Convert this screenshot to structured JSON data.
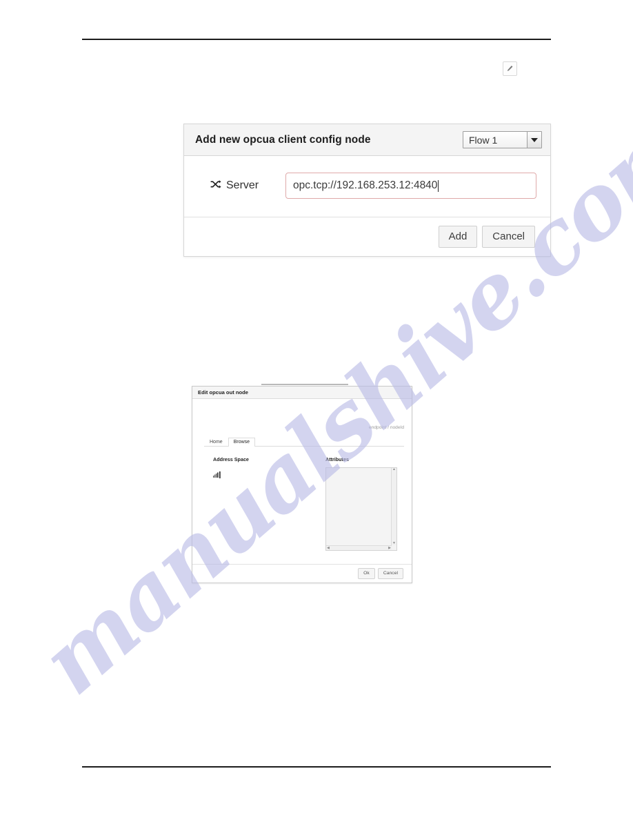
{
  "page": {
    "rules": {
      "top": "horizontal-rule",
      "bottom": "horizontal-rule"
    },
    "edit_button_icon": "pencil-icon"
  },
  "watermark": {
    "text": "manualshive.com",
    "color": "#b9bbe6"
  },
  "dialog_add_config": {
    "title": "Add new opcua client config node",
    "flow_select": {
      "selected": "Flow 1",
      "options": [
        "Flow 1"
      ],
      "arrow_icon": "chevron-down-icon"
    },
    "fields": [
      {
        "icon": "shuffle-icon",
        "label": "Server",
        "value": "opc.tcp://192.168.253.12:4840",
        "placeholder": "opc.tcp://",
        "border_color": "#dfa9a9"
      }
    ],
    "buttons": {
      "primary": "Add",
      "secondary": "Cancel"
    }
  },
  "dialog_edit_out_node": {
    "title": "Edit opcua out node",
    "breadcrumb": "endpoint / nodeId",
    "tabs": [
      {
        "label": "Home",
        "active": false
      },
      {
        "label": "Browse",
        "active": true
      }
    ],
    "columns": {
      "address_space": "Address Space",
      "attributes": "Attributes"
    },
    "tree_icon": "loading-bars-icon",
    "attributes_panel": {
      "content": "",
      "scroll_up_icon": "caret-up-icon",
      "scroll_down_icon": "caret-down-icon",
      "scroll_left_icon": "caret-left-icon",
      "scroll_right_icon": "caret-right-icon"
    },
    "buttons": {
      "primary": "Ok",
      "secondary": "Cancel"
    }
  }
}
